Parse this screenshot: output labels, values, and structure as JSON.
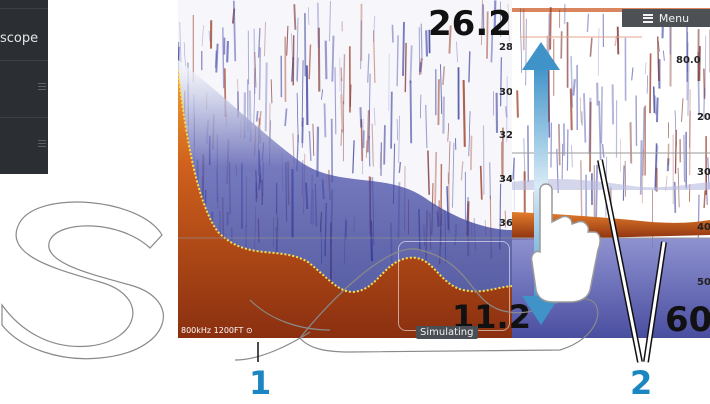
{
  "side_panel": {
    "label": "scope"
  },
  "left_view": {
    "depth_top": "26.2",
    "depth_bottom": "11.2",
    "scale": [
      "28",
      "30",
      "32",
      "34",
      "36"
    ],
    "status": "800kHz 1200FT ⊙",
    "simulating_label": "Simulating"
  },
  "right_view": {
    "menu_label": "Menu",
    "depth_value": "60",
    "scale_labels": [
      "80.0",
      "20",
      "30",
      "40",
      "50"
    ]
  },
  "callouts": {
    "one": "1",
    "two": "2"
  },
  "colors": {
    "callout": "#1a86c2",
    "bottom": "#c9531a",
    "arrow": "#3f93c9",
    "panel": "#2b2f33"
  },
  "icons": [
    "menu-icon",
    "scroll-arrow-icon",
    "hand-gesture-icon",
    "panel-grip-icon"
  ]
}
